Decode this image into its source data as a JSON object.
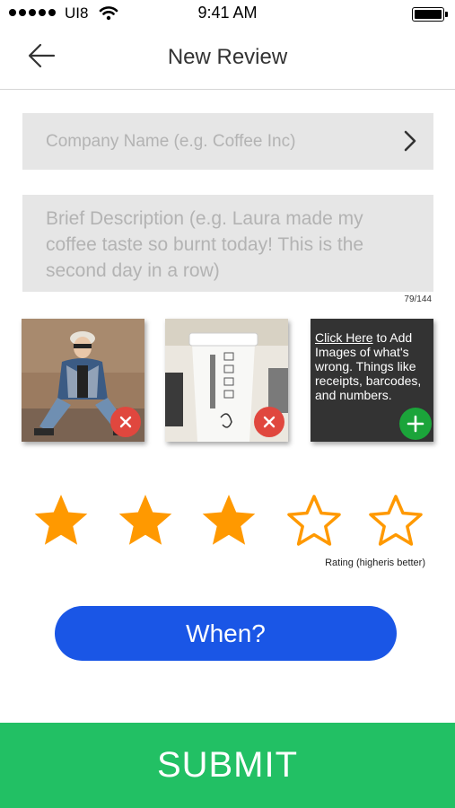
{
  "status_bar": {
    "carrier": "UI8",
    "time": "9:41 AM",
    "icons": [
      "signal-dots-icon",
      "wifi-icon",
      "battery-icon"
    ]
  },
  "nav": {
    "title": "New Review",
    "back_icon": "arrow-left-icon"
  },
  "company": {
    "placeholder": "Company Name (e.g. Coffee Inc)",
    "icon": "chevron-right-icon"
  },
  "description": {
    "placeholder": "Brief Description (e.g. Laura made my coffee taste so burnt today! This is the second day in a row)",
    "char_count": "79/144"
  },
  "photos": {
    "items": [
      {
        "subject": "person-photo",
        "action_icon": "close-icon"
      },
      {
        "subject": "coffee-cup-photo",
        "action_icon": "close-icon"
      }
    ],
    "add_tile": {
      "link_text": "Click Here",
      "text": " to Add Images of what's wrong. Things like receipts, barcodes, and numbers.",
      "action_icon": "plus-icon"
    }
  },
  "rating": {
    "value": 3,
    "max": 5,
    "caption": "Rating (higheris better)",
    "color": "#ff9900"
  },
  "when_button": {
    "label": "When?",
    "color": "#1a56e6"
  },
  "submit_button": {
    "label": "SUBMIT",
    "color": "#22c064"
  }
}
